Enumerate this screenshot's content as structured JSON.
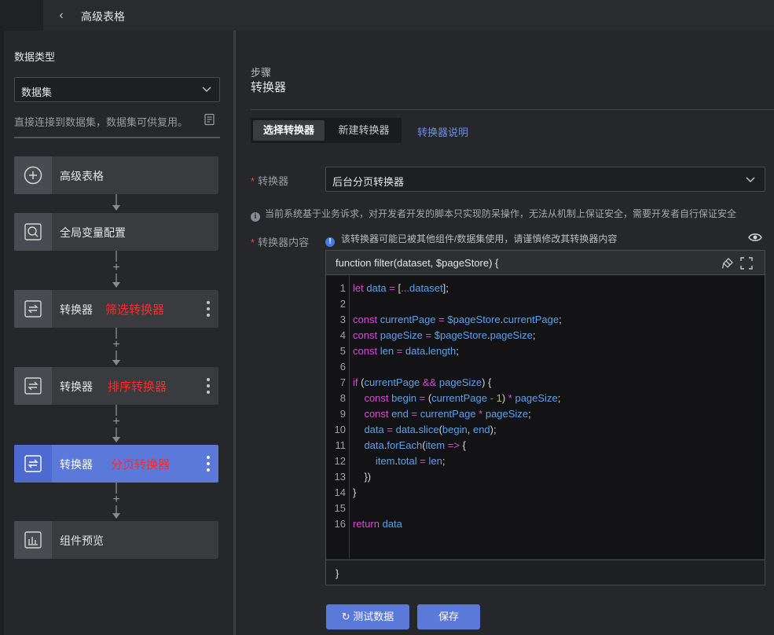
{
  "topbar": {
    "title": "高级表格",
    "back_glyph": "‹"
  },
  "sidebar": {
    "label": "数据类型",
    "select_value": "数据集",
    "description": "直接连接到数据集，数据集可供复用。",
    "nodes": [
      {
        "label": "高级表格",
        "icon": "plus-circle-icon"
      },
      {
        "label": "全局变量配置",
        "icon": "variable-search-icon"
      },
      {
        "label": "转换器",
        "tag": "筛选转换器",
        "icon": "convert-icon"
      },
      {
        "label": "转换器",
        "tag": "排序转换器",
        "icon": "convert-icon"
      },
      {
        "label": "转换器",
        "tag": "分页转换器",
        "icon": "convert-icon",
        "active": true
      },
      {
        "label": "组件预览",
        "icon": "chart-preview-icon"
      }
    ],
    "add_glyph": "+"
  },
  "main": {
    "step_label": "步骤",
    "step_title": "转换器",
    "tabs": {
      "selected": "选择转换器",
      "other": "新建转换器"
    },
    "help_link": "转换器说明",
    "converter_label": "转换器",
    "converter_value": "后台分页转换器",
    "info_text": "当前系统基于业务诉求，对开发者开发的脚本只实现防呆操作，无法从机制上保证安全，需要开发者自行保证安全",
    "content_label": "转换器内容",
    "warning_text": "该转换器可能已被其他组件/数据集使用，请谨慎修改其转换器内容",
    "required_mark": "*",
    "info_glyph": "i",
    "warn_glyph": "!",
    "editor": {
      "signature": "function filter(dataset, $pageStore) {",
      "closing": "}",
      "line_numbers": [
        "1",
        "2",
        "3",
        "4",
        "5",
        "6",
        "7",
        "8",
        "9",
        "10",
        "11",
        "12",
        "13",
        "14",
        "15",
        "16"
      ]
    },
    "buttons": {
      "test": "测试数据",
      "save": "保存",
      "refresh_glyph": "↻"
    }
  },
  "colors": {
    "accent": "#5a79d9",
    "red_tag": "#ff2a2a",
    "link": "#6e8fe6",
    "keyword": "#d24fd4",
    "identifier": "#5fa0e6",
    "number": "#8fd14f"
  }
}
